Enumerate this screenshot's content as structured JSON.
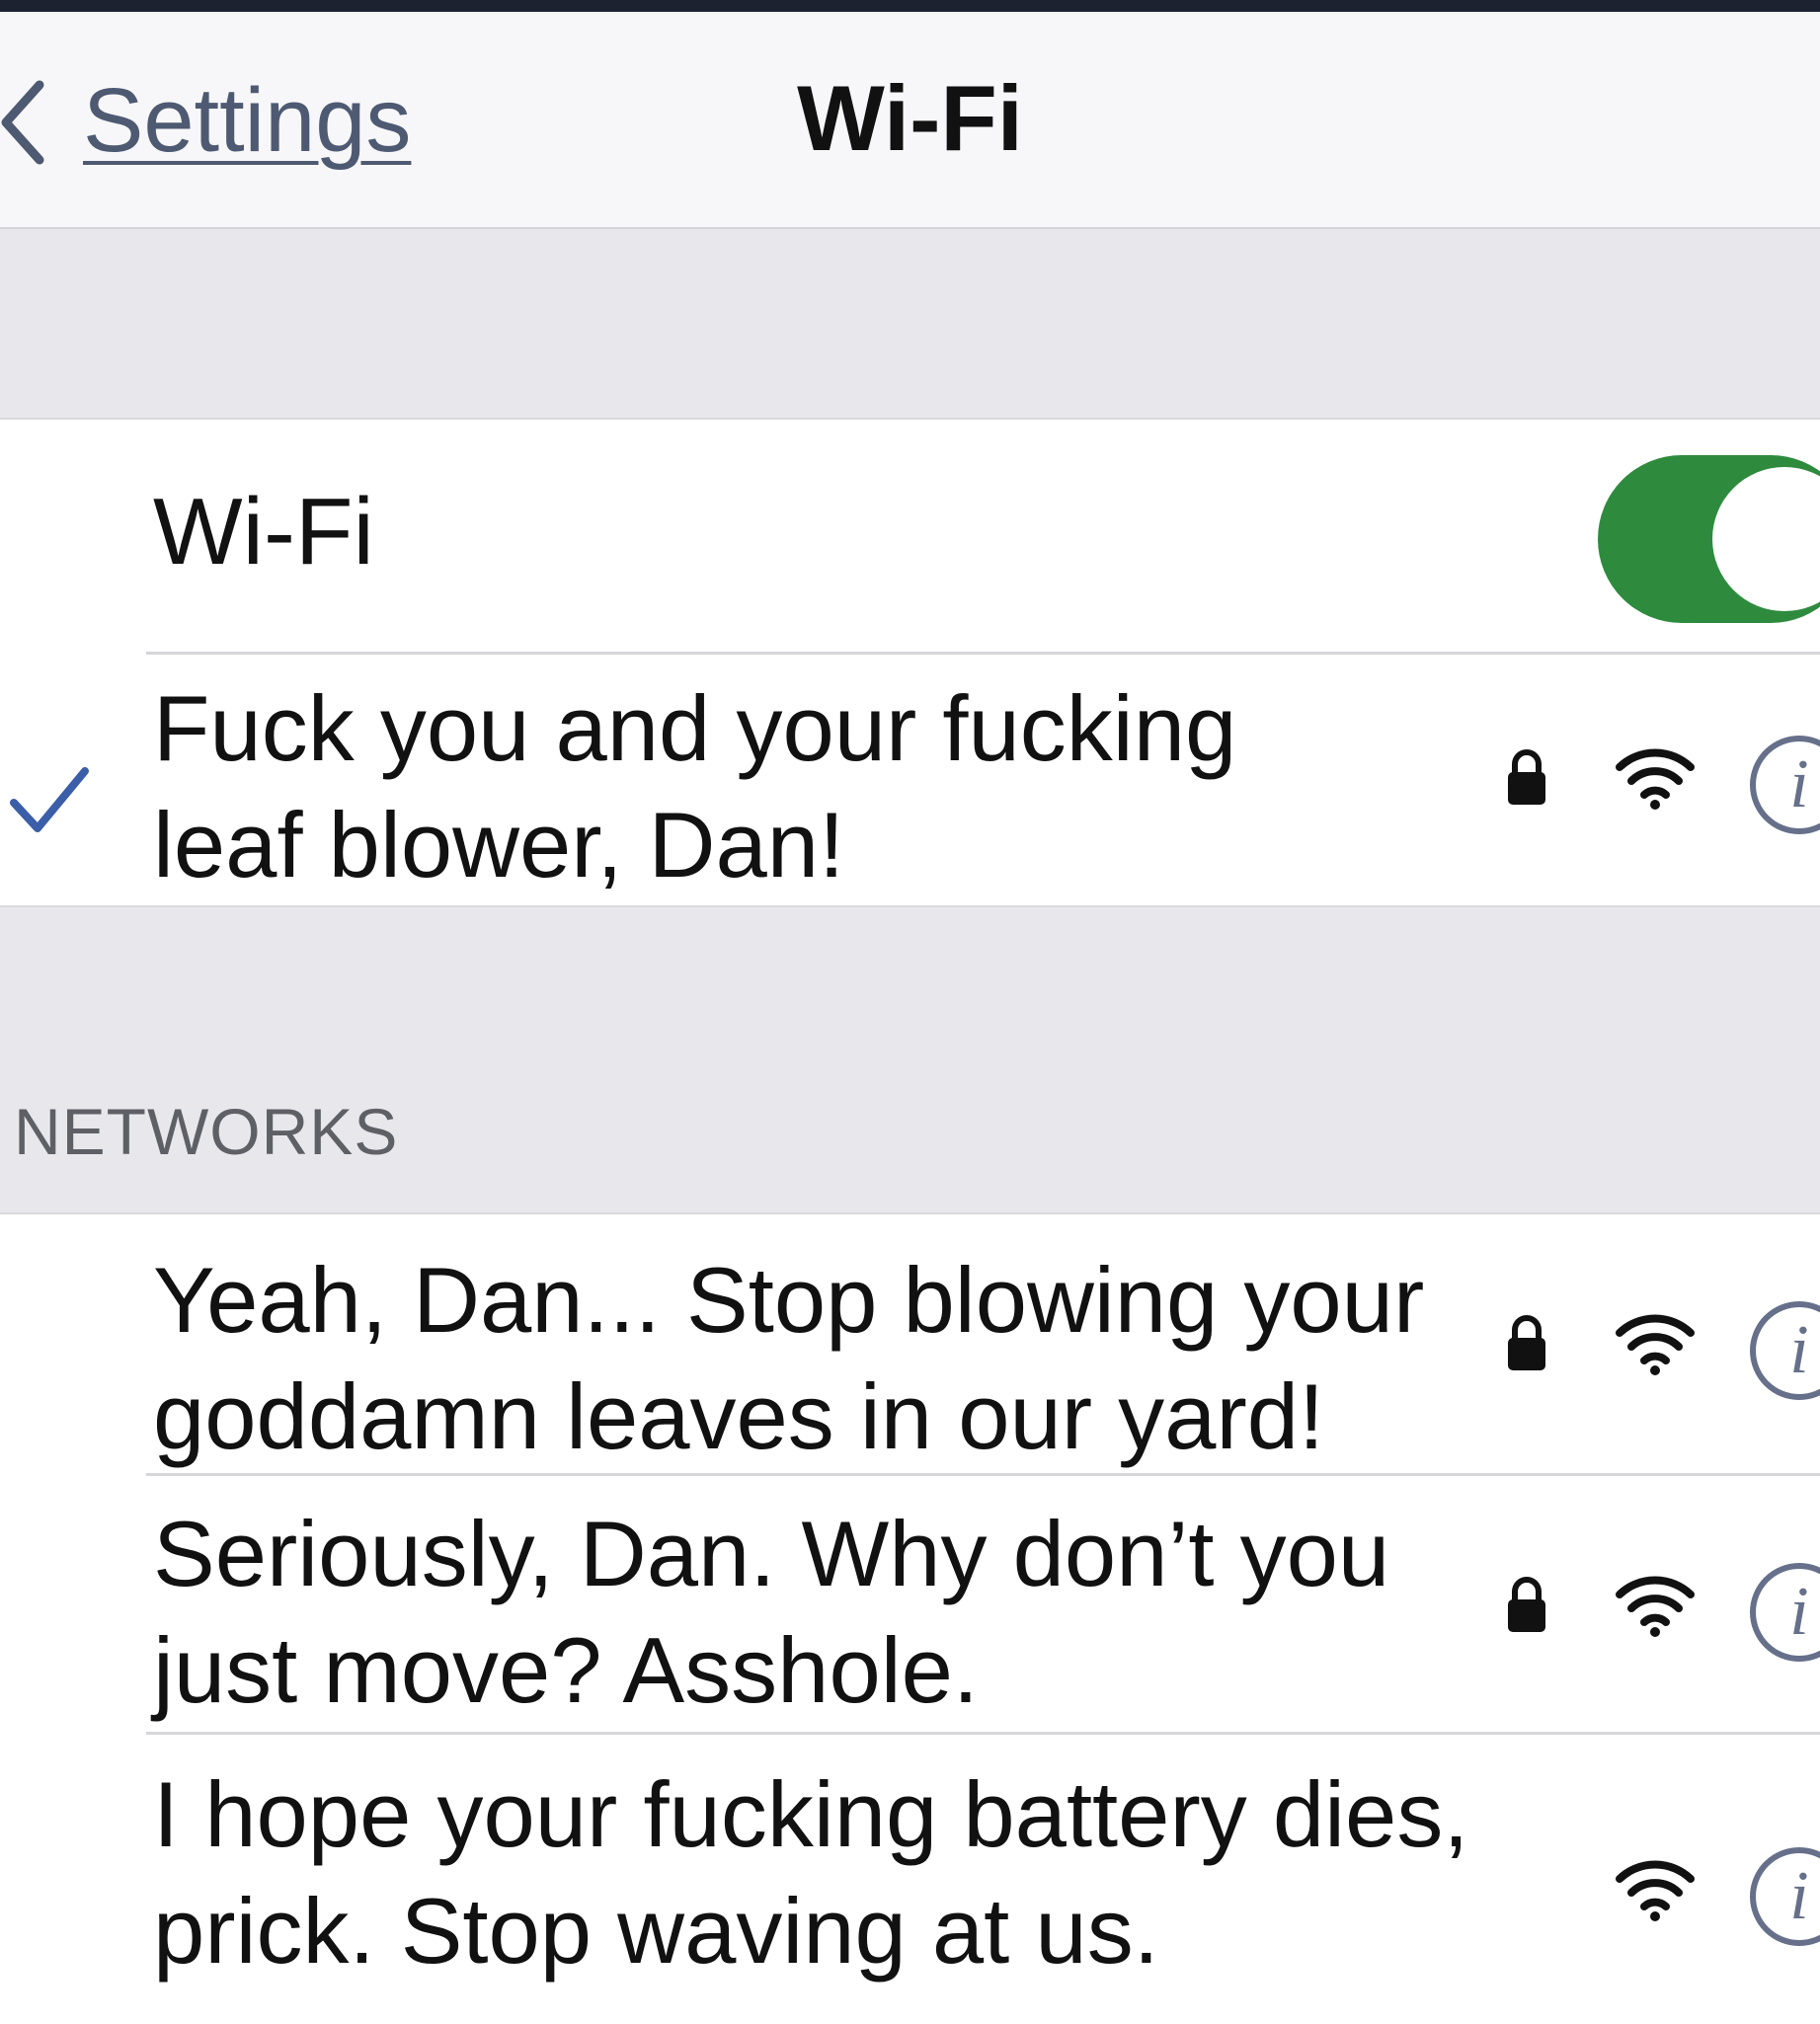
{
  "navbar": {
    "back_label": "Settings",
    "title": "Wi-Fi"
  },
  "wifi_toggle": {
    "label": "Wi-Fi",
    "on": true,
    "color": "#2e8b3e"
  },
  "connected_network": {
    "name_line1": "Fuck you and your fucking",
    "name_line2": "leaf blower, Dan!",
    "secured": true,
    "selected": true
  },
  "networks_section": {
    "header": "NETWORKS",
    "items": [
      {
        "name_line1": "Yeah, Dan... Stop blowing your",
        "name_line2": "goddamn leaves in our yard!",
        "secured": true
      },
      {
        "name_line1": "Seriously, Dan. Why don’t you",
        "name_line2": "just move? Asshole.",
        "secured": true
      },
      {
        "name_line1": "I hope your fucking battery dies,",
        "name_line2": "prick. Stop waving at us.",
        "secured": false
      }
    ]
  },
  "icons": {
    "back": "chevron-left-icon",
    "check": "checkmark-icon",
    "lock": "lock-icon",
    "wifi": "wifi-signal-icon",
    "info": "info-icon",
    "info_glyph": "i"
  }
}
